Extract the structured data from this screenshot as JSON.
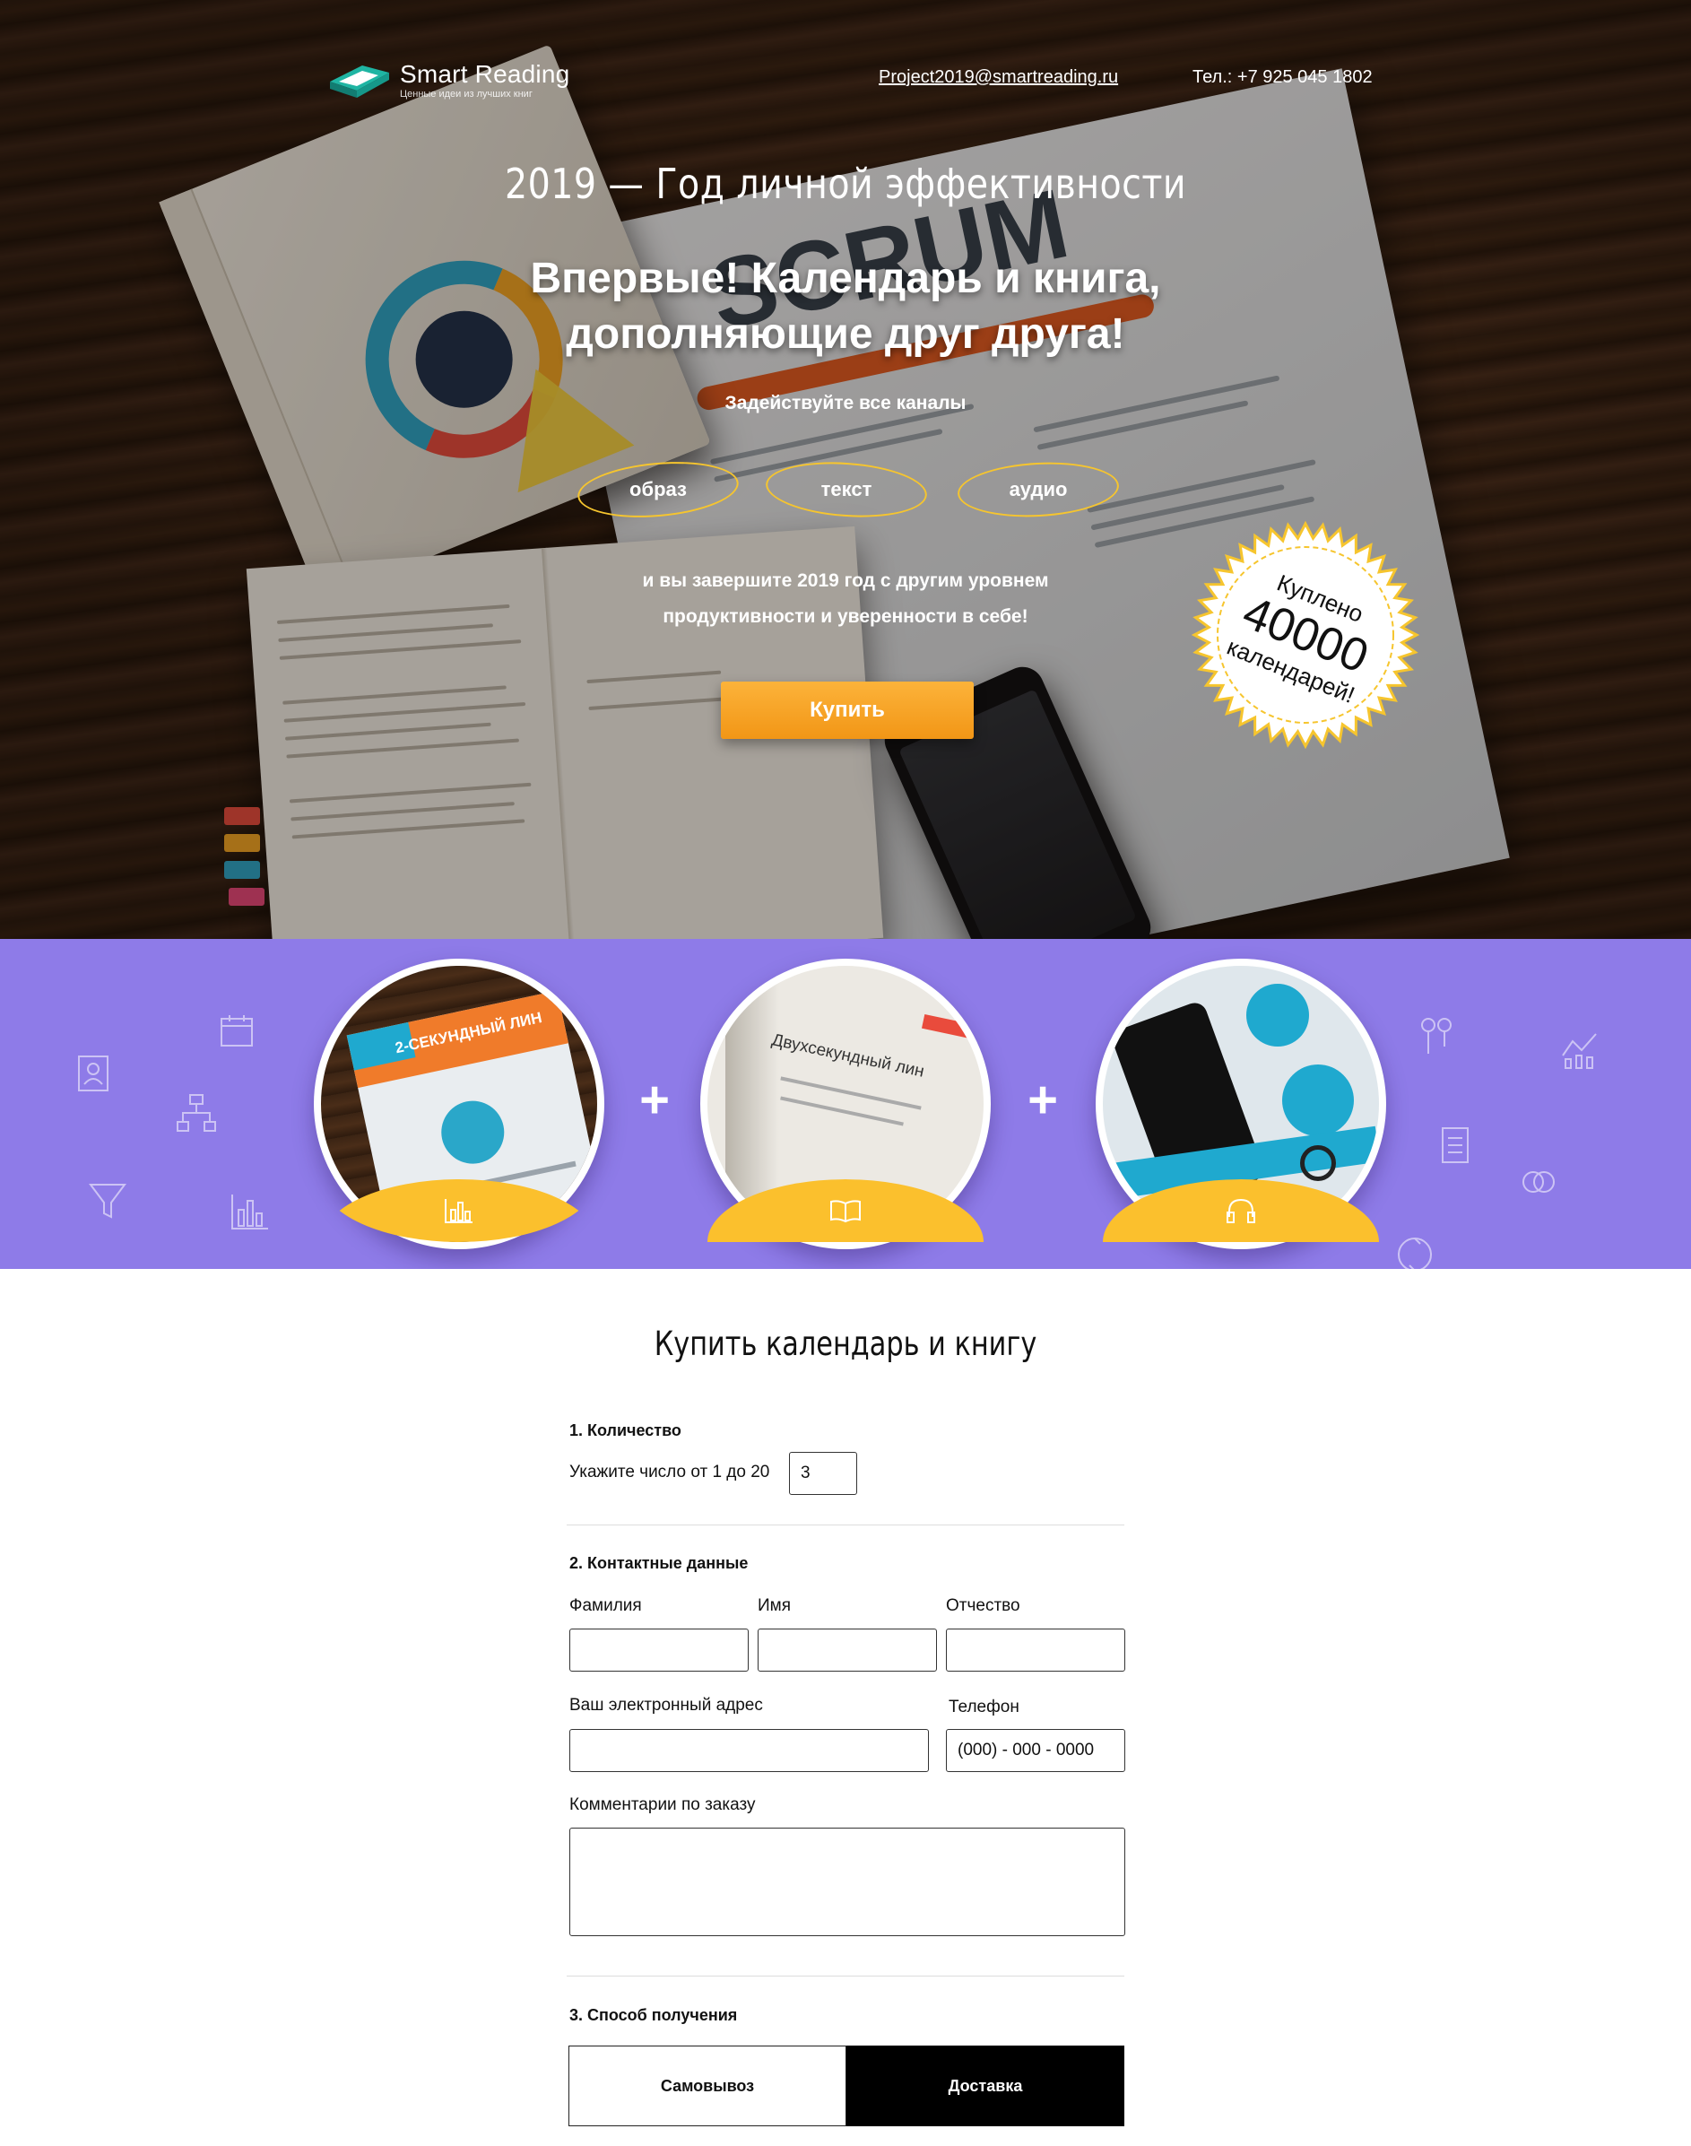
{
  "header": {
    "logo_name": "Smart Reading",
    "logo_tagline": "Ценные идеи из лучших книг",
    "email": "Project2019@smartreading.ru",
    "phone": "Тел.: +7 925 045 1802"
  },
  "hero": {
    "year_title": "2019 — Год личной эффективности",
    "headline_line1": "Впервые! Календарь и книга,",
    "headline_line2": "дополняющие друг друга!",
    "subtitle": "Задействуйте все каналы",
    "channels": [
      "образ",
      "текст",
      "аудио"
    ],
    "note_line1": "и вы завершите 2019 год с другим уровнем",
    "note_line2": "продуктивности и уверенности в себе!",
    "buy_label": "Купить",
    "seal": {
      "line1": "Куплено",
      "number": "40000",
      "line2": "календарей!"
    },
    "accent_color": "#f29616",
    "seal_color": "#f6c52e"
  },
  "band": {
    "color": "#8e7be8",
    "cards": [
      {
        "icon": "bar-chart-icon",
        "photo_text": "2-СЕКУНДНЫЙ ЛИН"
      },
      {
        "icon": "book-icon",
        "photo_text": "Двухсекундный лин"
      },
      {
        "icon": "headphones-icon",
        "photo_text": ""
      }
    ],
    "plus_sign": "+"
  },
  "form": {
    "title": "Купить календарь и книгу",
    "section1": {
      "title": "1. Количество",
      "label": "Укажите число от 1 до 20",
      "quantity_value": "3"
    },
    "section2": {
      "title": "2. Контактные данные",
      "last_name_label": "Фамилия",
      "first_name_label": "Имя",
      "middle_name_label": "Отчество",
      "email_label": "Ваш электронный адрес",
      "phone_label": "Телефон",
      "phone_placeholder": "(000) - 000 - 0000",
      "comment_label": "Комментарии по заказу"
    },
    "section3": {
      "title": "3. Способ получения",
      "options": [
        "Самовывоз",
        "Доставка"
      ],
      "selected": "Доставка"
    }
  }
}
